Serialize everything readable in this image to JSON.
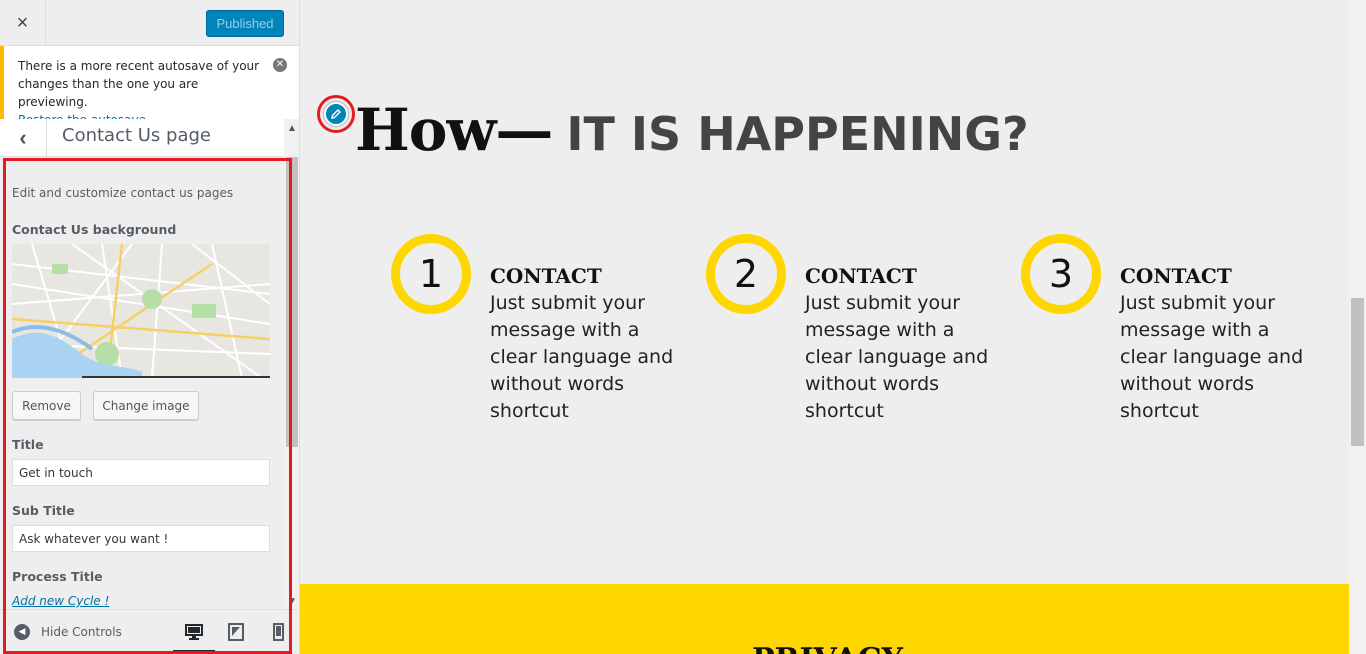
{
  "header": {
    "close_label": "×",
    "publish_label": "Published"
  },
  "notice": {
    "text": "There is a more recent autosave of your changes than the one you are previewing.",
    "link": "Restore the autosave"
  },
  "section": {
    "back_label": "‹",
    "title": "Contact Us page",
    "description": "Edit and customize contact us pages"
  },
  "background": {
    "label": "Contact Us background",
    "remove_label": "Remove",
    "change_label": "Change image"
  },
  "fields": {
    "title_label": "Title",
    "title_value": "Get in touch",
    "subtitle_label": "Sub Title",
    "subtitle_value": "Ask whatever you want !",
    "process_label": "Process Title",
    "add_cycle": "Add new Cycle !"
  },
  "footer": {
    "hide_controls": "Hide Controls",
    "devices": [
      "desktop-icon",
      "tablet-icon",
      "mobile-icon"
    ]
  },
  "preview": {
    "headline_how": "How—",
    "headline_rest": "IT IS HAPPENING?",
    "steps": [
      {
        "number": "1",
        "title": "CONTACT",
        "text": "Just submit your message with a clear language and without words shortcut"
      },
      {
        "number": "2",
        "title": "CONTACT",
        "text": "Just submit your message with a clear language and without words shortcut"
      },
      {
        "number": "3",
        "title": "CONTACT",
        "text": "Just submit your message with a clear language and without words shortcut"
      }
    ],
    "band_title": "PRIVACY"
  },
  "colors": {
    "accent": "#fed700",
    "primary_button": "#0085ba",
    "highlight_outline": "#e21b23",
    "notice_border": "#ffb900"
  }
}
